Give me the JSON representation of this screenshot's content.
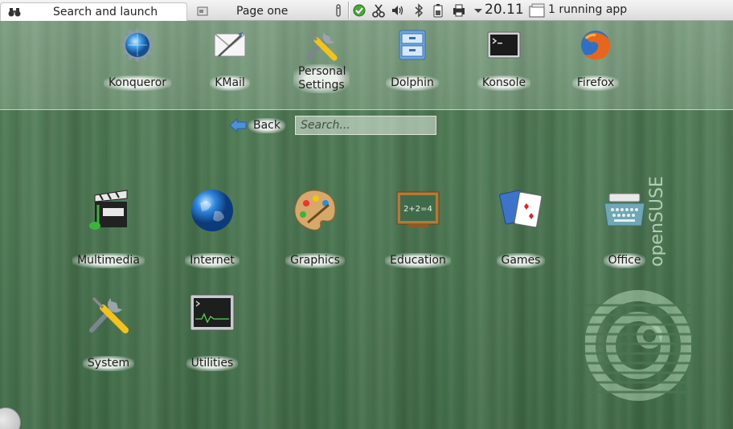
{
  "panel": {
    "active_tab": "Search and launch",
    "inactive_tab": "Page one",
    "tray_icons": [
      "info-icon",
      "network-icon",
      "scissors-icon",
      "volume-icon",
      "bluetooth-icon",
      "battery-icon",
      "printer-icon",
      "dropdown-arrow-icon"
    ],
    "clock": "20.11",
    "running_apps": "1 running app"
  },
  "favorites": [
    {
      "label": "Konqueror",
      "icon": "konqueror-icon"
    },
    {
      "label": "KMail",
      "icon": "kmail-icon"
    },
    {
      "label": "Personal Settings",
      "icon": "personal-settings-icon"
    },
    {
      "label": "Dolphin",
      "icon": "dolphin-icon"
    },
    {
      "label": "Konsole",
      "icon": "konsole-icon"
    },
    {
      "label": "Firefox",
      "icon": "firefox-icon"
    }
  ],
  "nav": {
    "back_label": "Back",
    "search_placeholder": "Search..."
  },
  "categories": [
    {
      "label": "Multimedia",
      "icon": "multimedia-icon"
    },
    {
      "label": "Internet",
      "icon": "internet-icon"
    },
    {
      "label": "Graphics",
      "icon": "graphics-icon"
    },
    {
      "label": "Education",
      "icon": "education-icon"
    },
    {
      "label": "Games",
      "icon": "games-icon"
    },
    {
      "label": "Office",
      "icon": "office-icon"
    },
    {
      "label": "System",
      "icon": "system-icon"
    },
    {
      "label": "Utilities",
      "icon": "utilities-icon"
    }
  ],
  "brand": {
    "text": "openSUSE"
  },
  "colors": {
    "background": "#4a7550",
    "panel": "#e6e6e6",
    "accent_blue": "#3d8fe0"
  }
}
